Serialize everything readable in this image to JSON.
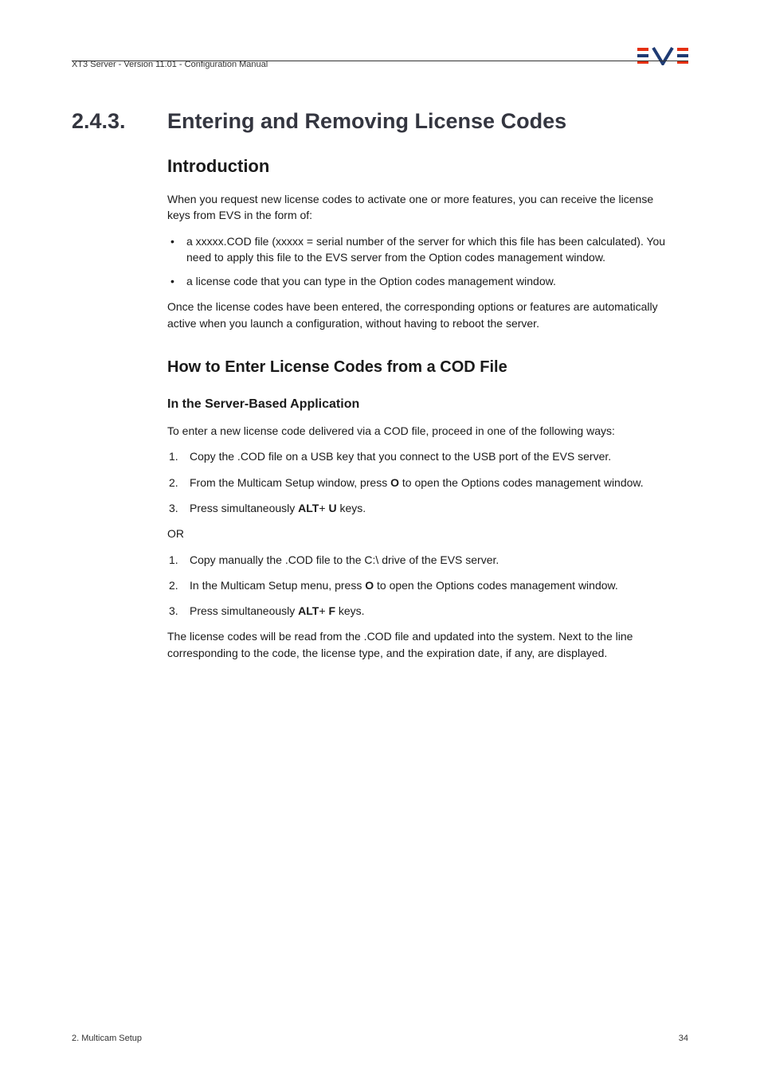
{
  "header": {
    "doc_title": "XT3 Server - Version 11.01 - Configuration Manual"
  },
  "section": {
    "number": "2.4.3.",
    "title": "Entering and Removing License Codes"
  },
  "intro": {
    "heading": "Introduction",
    "p1": "When you request new license codes to activate one or more features, you can receive the license keys from EVS in the form of:",
    "bullets": [
      "a xxxxx.COD file (xxxxx = serial number of the server for which this file has been calculated). You need to apply this file to the EVS server from the Option codes management window.",
      "a license code that you can type in the Option codes management window."
    ],
    "p2": "Once the license codes have been entered, the corresponding options or features are automatically active when you launch a configuration, without having to reboot the server."
  },
  "howto": {
    "heading": "How to Enter License Codes from a COD File",
    "sub_heading": "In the Server-Based Application",
    "p1": "To enter a new license code delivered via a COD file, proceed in one of the following ways:",
    "list1": {
      "i1": "Copy the .COD file on a USB key that you connect to the USB port of the EVS server.",
      "i2_a": "From the Multicam Setup window, press ",
      "i2_b": "O",
      "i2_c": " to open the Options codes management window.",
      "i3_a": "Press simultaneously ",
      "i3_b": "ALT",
      "i3_c": "+ ",
      "i3_d": "U",
      "i3_e": " keys."
    },
    "or": "OR",
    "list2": {
      "i1": "Copy manually the .COD file to the C:\\ drive of the EVS server.",
      "i2_a": "In the Multicam Setup menu, press ",
      "i2_b": "O",
      "i2_c": " to open the Options codes management window.",
      "i3_a": "Press simultaneously ",
      "i3_b": "ALT",
      "i3_c": "+ ",
      "i3_d": "F",
      "i3_e": " keys."
    },
    "p2": "The license codes will be read from the .COD file and updated into the system. Next to the line corresponding to the code, the license type, and the expiration date, if any, are displayed."
  },
  "footer": {
    "left": "2. Multicam Setup",
    "right": "34"
  }
}
